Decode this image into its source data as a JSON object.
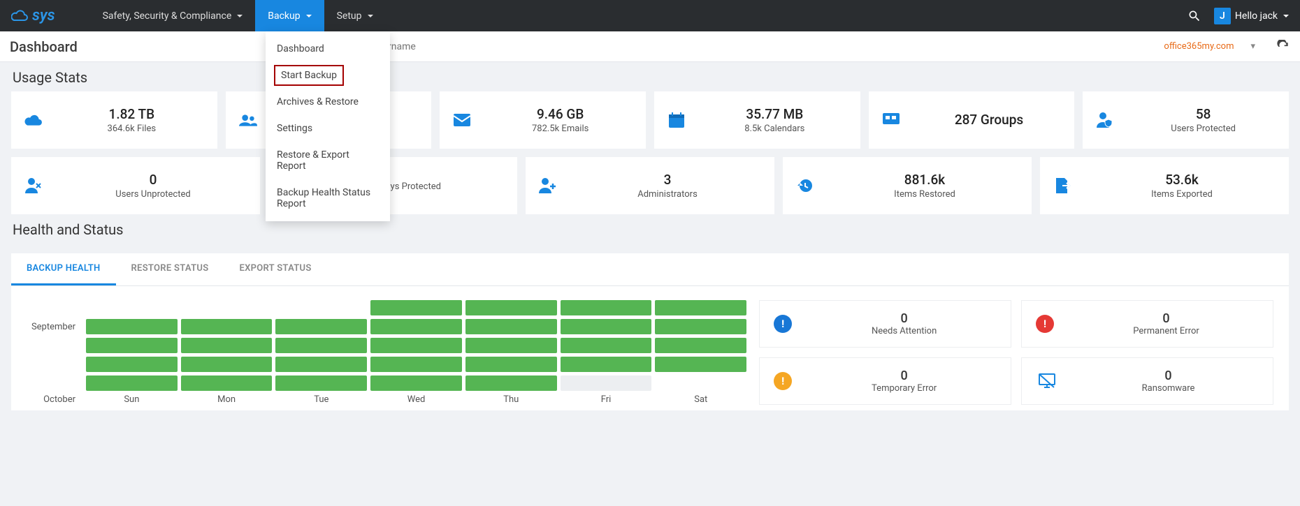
{
  "brand": {
    "text": "sys",
    "sub": "CLOUD"
  },
  "nav": [
    {
      "label": "Safety, Security & Compliance"
    },
    {
      "label": "Backup"
    },
    {
      "label": "Setup"
    }
  ],
  "user": {
    "initial": "J",
    "greeting": "Hello jack"
  },
  "page": {
    "title": "Dashboard",
    "search_placeholder": "Enter username",
    "domain": "office365my.com"
  },
  "dropdown": [
    "Dashboard",
    "Start Backup",
    "Archives & Restore",
    "Settings",
    "Restore & Export Report",
    "Backup Health Status Report"
  ],
  "usage_title": "Usage Stats",
  "stats_row1": [
    {
      "value": "1.82 TB",
      "label": "364.6k Files"
    },
    {
      "value": "",
      "label": ""
    },
    {
      "value": "9.46 GB",
      "label": "782.5k Emails"
    },
    {
      "value": "35.77 MB",
      "label": "8.5k Calendars"
    },
    {
      "value": "287 Groups",
      "label": ""
    },
    {
      "value": "58",
      "label": "Users Protected"
    }
  ],
  "stats_row2": [
    {
      "value": "0",
      "label": "Users Unprotected"
    },
    {
      "value": "",
      "label": "Days Protected"
    },
    {
      "value": "3",
      "label": "Administrators"
    },
    {
      "value": "881.6k",
      "label": "Items Restored"
    },
    {
      "value": "53.6k",
      "label": "Items Exported"
    }
  ],
  "health_title": "Health and Status",
  "tabs": [
    "BACKUP HEALTH",
    "RESTORE STATUS",
    "EXPORT STATUS"
  ],
  "calendar": {
    "months": [
      "September",
      "October"
    ],
    "days": [
      "Sun",
      "Mon",
      "Tue",
      "Wed",
      "Thu",
      "Fri",
      "Sat"
    ]
  },
  "status": [
    {
      "value": "0",
      "label": "Needs Attention",
      "color": "#1877d6",
      "icon": "!"
    },
    {
      "value": "0",
      "label": "Permanent Error",
      "color": "#e53935",
      "icon": "!"
    },
    {
      "value": "0",
      "label": "Temporary Error",
      "color": "#f5a623",
      "icon": "!"
    },
    {
      "value": "0",
      "label": "Ransomware",
      "color": "#1887e0",
      "icon": "monitor"
    }
  ]
}
